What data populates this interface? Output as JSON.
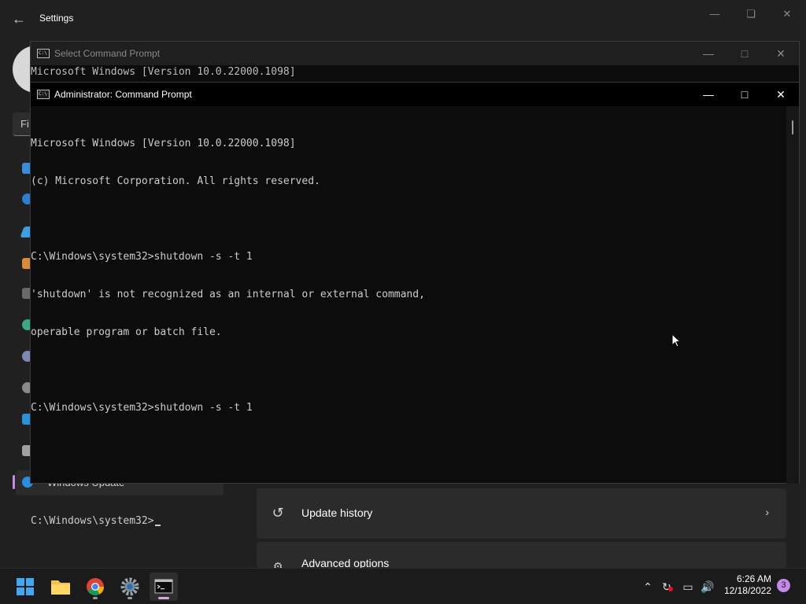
{
  "settings": {
    "title": "Settings",
    "find_placeholder": "Fi",
    "active_nav_label": "Windows Update",
    "cards": [
      {
        "label": "Update history",
        "icon": "history-icon"
      },
      {
        "label": "Advanced options",
        "icon": "gear-icon"
      }
    ]
  },
  "cmd_back": {
    "title": "Select Command Prompt",
    "line1": "Microsoft Windows [Version 10.0.22000.1098]"
  },
  "cmd_front": {
    "title": "Administrator: Command Prompt",
    "lines": [
      "Microsoft Windows [Version 10.0.22000.1098]",
      "(c) Microsoft Corporation. All rights reserved.",
      "",
      "C:\\Windows\\system32>shutdown -s -t 1",
      "'shutdown' is not recognized as an internal or external command,",
      "operable program or batch file.",
      "",
      "C:\\Windows\\system32>shutdown -s -t 1",
      "",
      ""
    ],
    "prompt": "C:\\Windows\\system32>"
  },
  "taskbar": {
    "time": "6:26 AM",
    "date": "12/18/2022",
    "notification_count": "3"
  },
  "colors": {
    "accent": "#c589e8",
    "console_bg": "#0c0c0c",
    "console_text": "#cccccc"
  }
}
